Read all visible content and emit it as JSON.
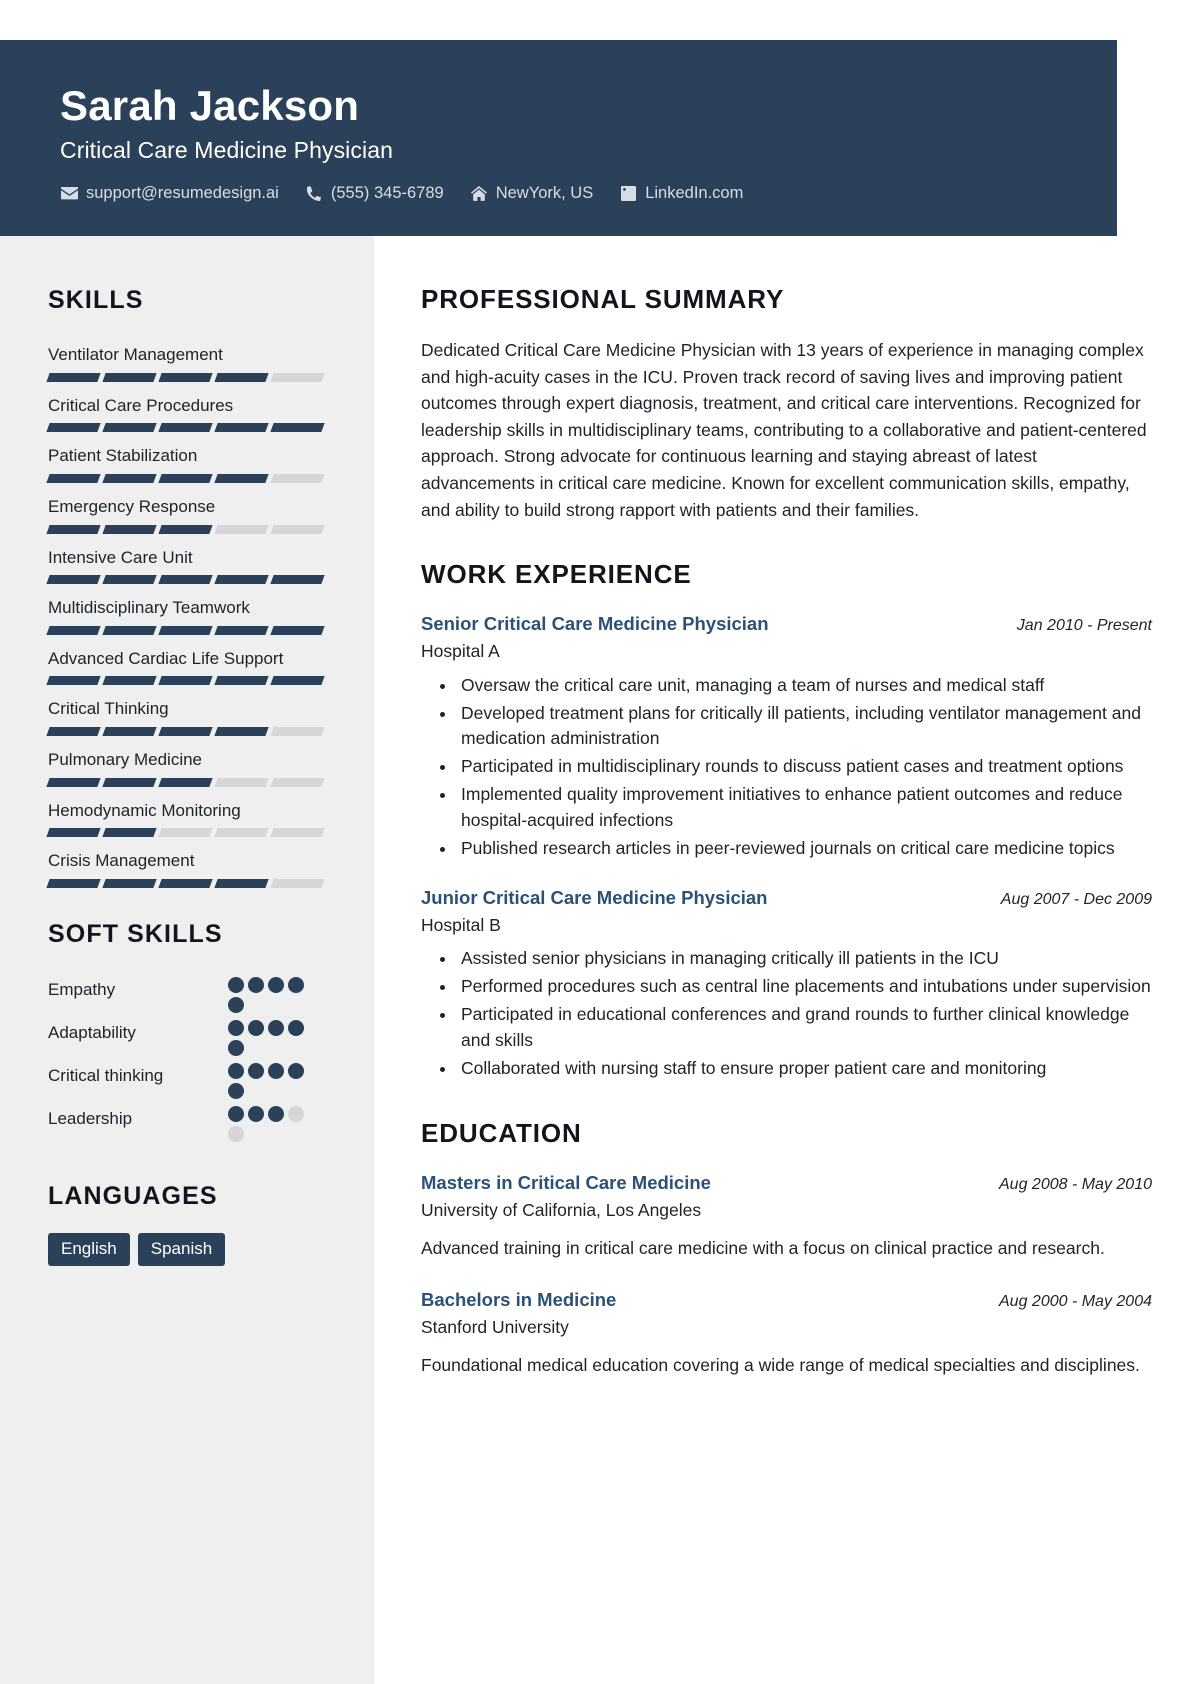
{
  "theme": {
    "navy": "#2b4159",
    "link_blue": "#2b5178",
    "sidebar_bg": "#efefef",
    "bar_empty": "#d6d6d6",
    "text": "#1d2329"
  },
  "header": {
    "name": "Sarah Jackson",
    "job_title": "Critical Care Medicine Physician",
    "contacts": [
      {
        "icon": "envelope-icon",
        "text": "support@resumedesign.ai"
      },
      {
        "icon": "phone-icon",
        "text": "(555) 345-6789"
      },
      {
        "icon": "home-icon",
        "text": "NewYork, US"
      },
      {
        "icon": "linkedin-icon",
        "text": "LinkedIn.com"
      }
    ]
  },
  "sidebar": {
    "skills_heading": "SKILLS",
    "skill_levels_max": 5,
    "skills": [
      {
        "label": "Ventilator Management",
        "level": 4
      },
      {
        "label": "Critical Care Procedures",
        "level": 5
      },
      {
        "label": "Patient Stabilization",
        "level": 4
      },
      {
        "label": "Emergency Response",
        "level": 3
      },
      {
        "label": "Intensive Care Unit",
        "level": 5
      },
      {
        "label": "Multidisciplinary Teamwork",
        "level": 5
      },
      {
        "label": "Advanced Cardiac Life Support",
        "level": 5
      },
      {
        "label": "Critical Thinking",
        "level": 4
      },
      {
        "label": "Pulmonary Medicine",
        "level": 3
      },
      {
        "label": "Hemodynamic Monitoring",
        "level": 2
      },
      {
        "label": "Crisis Management",
        "level": 4
      }
    ],
    "soft_skills_heading": "SOFT SKILLS",
    "soft_skills_max": 5,
    "soft_skills": [
      {
        "label": "Empathy",
        "level": 5
      },
      {
        "label": "Adaptability",
        "level": 5
      },
      {
        "label": "Critical thinking",
        "level": 5
      },
      {
        "label": "Leadership",
        "level": 3
      }
    ],
    "languages_heading": "LANGUAGES",
    "languages": [
      "English",
      "Spanish"
    ]
  },
  "main": {
    "summary_heading": "PROFESSIONAL SUMMARY",
    "summary_text": "Dedicated Critical Care Medicine Physician with 13 years of experience in managing complex and high-acuity cases in the ICU. Proven track record of saving lives and improving patient outcomes through expert diagnosis, treatment, and critical care interventions. Recognized for leadership skills in multidisciplinary teams, contributing to a collaborative and patient-centered approach. Strong advocate for continuous learning and staying abreast of latest advancements in critical care medicine. Known for excellent communication skills, empathy, and ability to build strong rapport with patients and their families.",
    "work_heading": "WORK EXPERIENCE",
    "work": [
      {
        "title": "Senior Critical Care Medicine Physician",
        "date": "Jan 2010 - Present",
        "org": "Hospital A",
        "bullets": [
          "Oversaw the critical care unit, managing a team of nurses and medical staff",
          "Developed treatment plans for critically ill patients, including ventilator management and medication administration",
          "Participated in multidisciplinary rounds to discuss patient cases and treatment options",
          "Implemented quality improvement initiatives to enhance patient outcomes and reduce hospital-acquired infections",
          "Published research articles in peer-reviewed journals on critical care medicine topics"
        ]
      },
      {
        "title": "Junior Critical Care Medicine Physician",
        "date": "Aug 2007 - Dec 2009",
        "org": "Hospital B",
        "bullets": [
          "Assisted senior physicians in managing critically ill patients in the ICU",
          "Performed procedures such as central line placements and intubations under supervision",
          "Participated in educational conferences and grand rounds to further clinical knowledge and skills",
          "Collaborated with nursing staff to ensure proper patient care and monitoring"
        ]
      }
    ],
    "education_heading": "EDUCATION",
    "education": [
      {
        "title": "Masters in Critical Care Medicine",
        "date": "Aug 2008 - May 2010",
        "org": "University of California, Los Angeles",
        "description": "Advanced training in critical care medicine with a focus on clinical practice and research."
      },
      {
        "title": "Bachelors in Medicine",
        "date": "Aug 2000 - May 2004",
        "org": "Stanford University",
        "description": "Foundational medical education covering a wide range of medical specialties and disciplines."
      }
    ]
  }
}
